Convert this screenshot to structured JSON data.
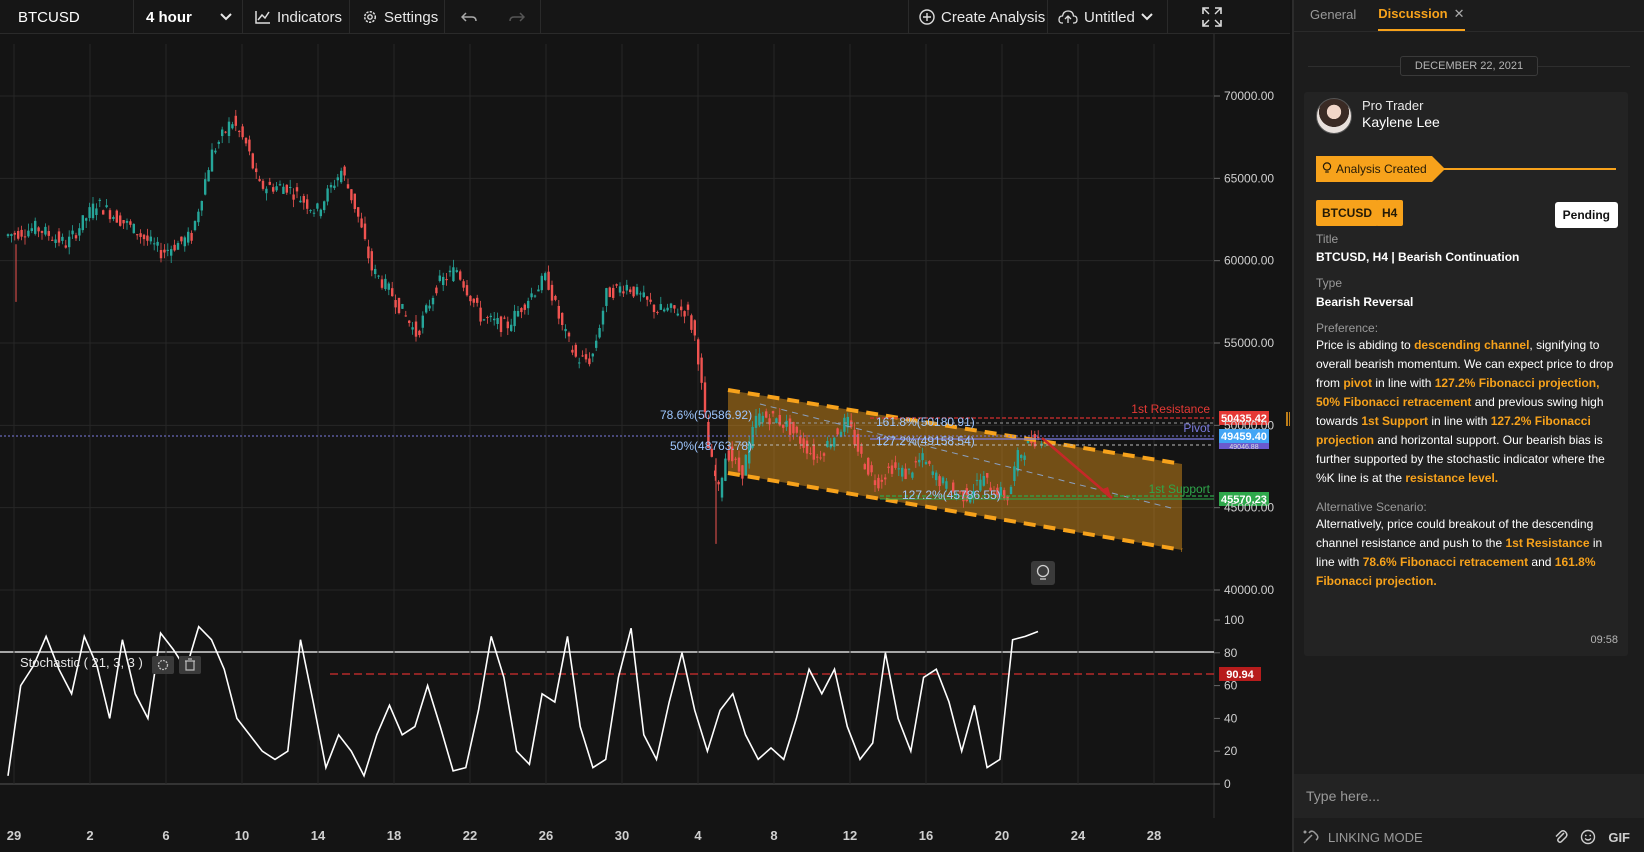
{
  "toolbar": {
    "symbol": "BTCUSD",
    "interval": "4 hour",
    "indicators_label": "Indicators",
    "settings_label": "Settings",
    "create_label": "Create Analysis",
    "layout_label": "Untitled",
    "icons": [
      "chart-line-icon",
      "gear-icon",
      "undo-icon",
      "redo-icon",
      "plus-circle-icon",
      "cloud-upload-icon",
      "fullscreen-icon"
    ]
  },
  "chart": {
    "price_labels": [
      "70000.00",
      "65000.00",
      "60000.00",
      "55000.00",
      "50000.00",
      "45000.00",
      "40000.00"
    ],
    "osc_labels": [
      "100",
      "80",
      "60",
      "40",
      "20",
      "0"
    ],
    "x_labels": [
      "29",
      "2",
      "6",
      "10",
      "14",
      "18",
      "22",
      "26",
      "30",
      "4",
      "8",
      "12",
      "16",
      "20",
      "24",
      "28"
    ],
    "indicator_title": "Stochastic ( 21, 3, 3 )",
    "resistance_label": "1st Resistance",
    "pivot_label": "Pivot",
    "support_label": "1st Support",
    "fib_786": "78.6%(50586.92)",
    "fib_50": "50%(48763.78)",
    "fib_1618": "161.8%(50180.91)",
    "fib_1272_upper": "127.2%(49158.54)",
    "fib_1272_lower": "127.2%(45786.55)",
    "badge_resistance": "50435.42",
    "badge_pivot": "49459.40",
    "badge_pivot_sub": "49046.88",
    "badge_support": "45570.23",
    "badge_osc": "90.94",
    "colors": {
      "up": "#26a69a",
      "down": "#ef5350",
      "channel": "#f7a21b",
      "resistance": "#d32f2f",
      "support": "#2ea84b",
      "pivot": "#7b7be0"
    }
  },
  "panel": {
    "tabs": [
      "General",
      "Discussion"
    ],
    "date": "DECEMBER 22, 2021",
    "author_role": "Pro Trader",
    "author_name": "Kaylene Lee",
    "status": "Analysis Created",
    "tag_symbol": "BTCUSD",
    "tag_timeframe": "H4",
    "pending_label": "Pending",
    "title_label": "Title",
    "title_value": "BTCUSD, H4 | Bearish Continuation",
    "type_label": "Type",
    "type_value": "Bearish Reversal",
    "preference_label": "Preference:",
    "preference": {
      "p1": "Price is abiding to ",
      "h1": "descending channel",
      "p2": ", signifying to overall bearish momentum. We can expect price to drop from ",
      "h2": "pivot",
      "p3": " in line with ",
      "h3": "127.2% Fibonacci projection, 50% Fibonacci retracement",
      "p4": " and previous swing high towards ",
      "h4": "1st Support",
      "p5": " in line with ",
      "h5": "127.2% Fibonacci projection",
      "p6": " and horizontal support. Our bearish bias is further supported by the stochastic indicator where the %K line is at the ",
      "h6": "resistance level."
    },
    "alt_label": "Alternative Scenario:",
    "alternative": {
      "p1": "Alternatively, price could breakout of the descending channel resistance and push to the ",
      "h1": "1st Resistance",
      "p2": " in line with ",
      "h2": "78.6% Fibonacci retracement",
      "p3": " and ",
      "h3": "161.8% Fibonacci projection."
    },
    "time": "09:58",
    "composer_placeholder": "Type here...",
    "linking_mode": "LINKING MODE",
    "gif_label": "GIF"
  }
}
